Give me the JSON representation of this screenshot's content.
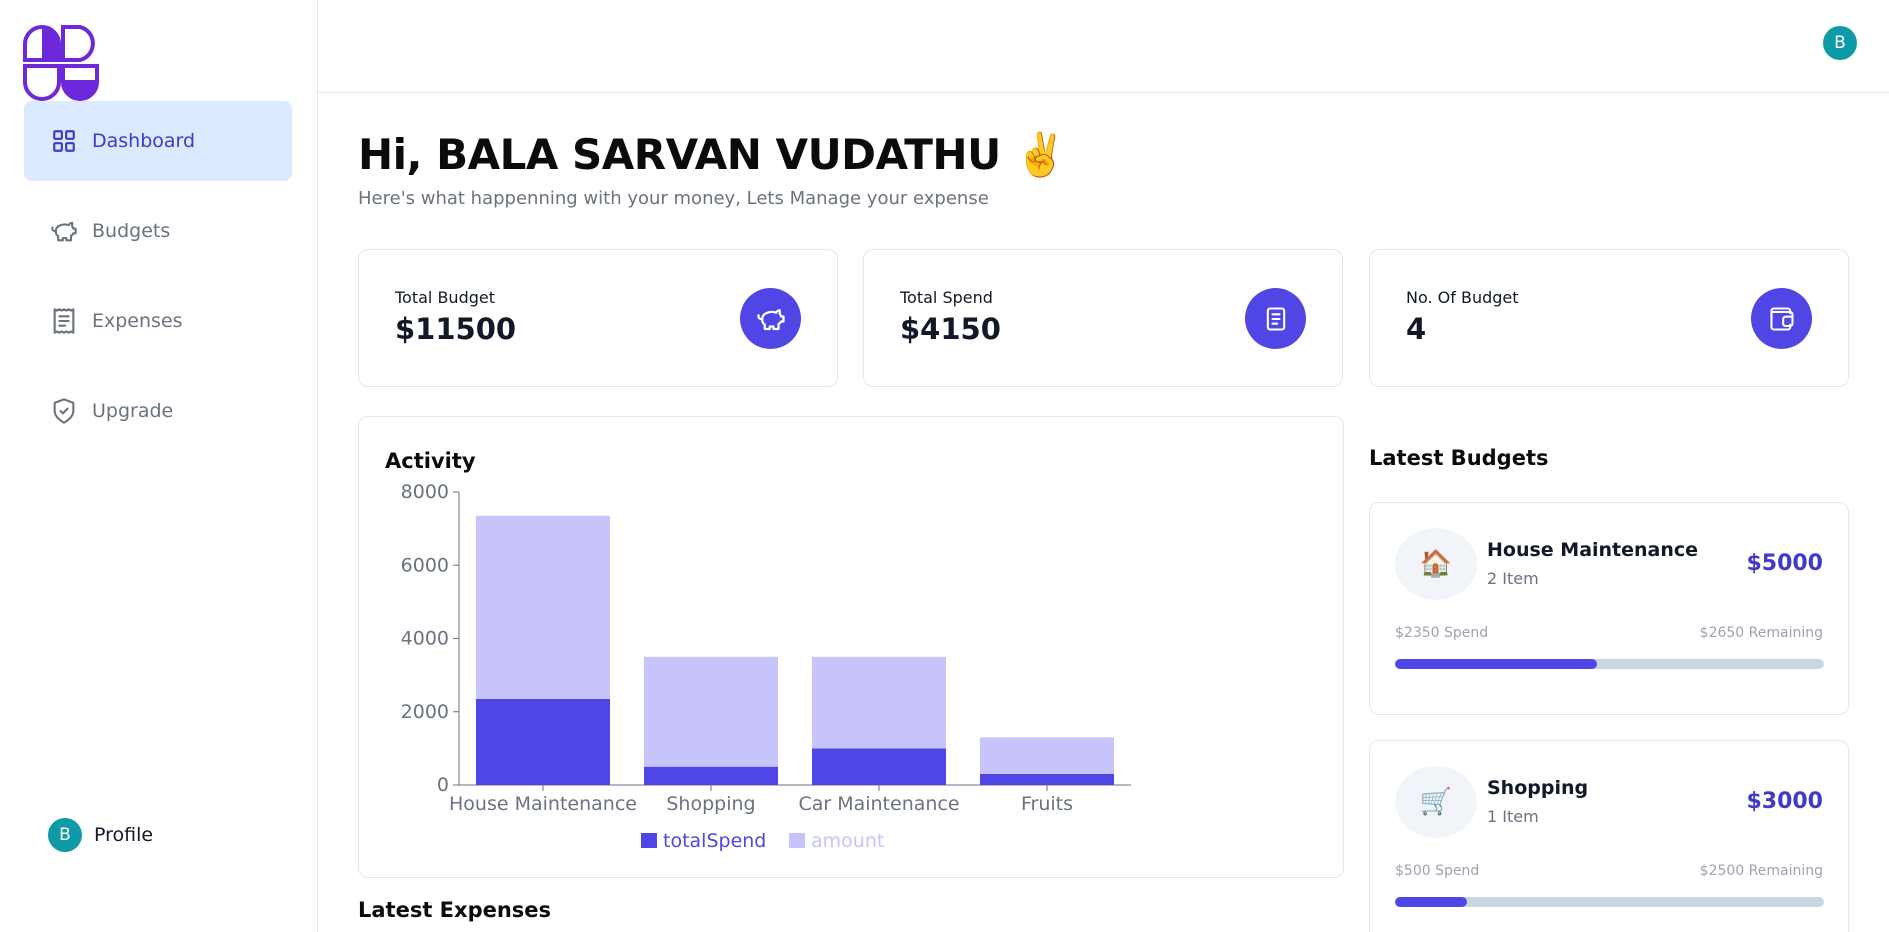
{
  "sidebar": {
    "items": [
      {
        "label": "Dashboard",
        "icon": "dashboard-icon",
        "active": true
      },
      {
        "label": "Budgets",
        "icon": "piggy-bank-icon",
        "active": false
      },
      {
        "label": "Expenses",
        "icon": "receipt-icon",
        "active": false
      },
      {
        "label": "Upgrade",
        "icon": "shield-check-icon",
        "active": false
      }
    ],
    "profile_label": "Profile",
    "profile_initial": "B"
  },
  "header": {
    "avatar_initial": "B"
  },
  "greeting": {
    "title": "Hi, BALA SARVAN VUDATHU ✌️",
    "subtitle": "Here's what happenning with your money, Lets Manage your expense"
  },
  "stats": [
    {
      "label": "Total Budget",
      "value": "$11500",
      "icon": "piggy-bank-icon"
    },
    {
      "label": "Total Spend",
      "value": "$4150",
      "icon": "receipt-icon"
    },
    {
      "label": "No. Of Budget",
      "value": "4",
      "icon": "wallet-icon"
    }
  ],
  "activity": {
    "title": "Activity"
  },
  "chart_data": {
    "type": "bar",
    "stacked": true,
    "categories": [
      "House Maintenance",
      "Shopping",
      "Car Maintenance",
      "Fruits"
    ],
    "series": [
      {
        "name": "totalSpend",
        "values": [
          2350,
          500,
          1000,
          300
        ],
        "color": "#4f46e5"
      },
      {
        "name": "amount",
        "values": [
          5000,
          3000,
          2500,
          1000
        ],
        "color": "#c7c4fc"
      }
    ],
    "ylim": [
      0,
      8000
    ],
    "yticks": [
      0,
      2000,
      4000,
      6000,
      8000
    ],
    "legend": "bottom",
    "grid": false
  },
  "latest_budgets": {
    "title": "Latest Budgets",
    "items": [
      {
        "emoji": "🏠",
        "name": "House Maintenance",
        "items": "2 Item",
        "amount": "$5000",
        "spend": "$2350 Spend",
        "remaining": "$2650 Remaining",
        "progress": 0.47
      },
      {
        "emoji": "🛒",
        "name": "Shopping",
        "items": "1 Item",
        "amount": "$3000",
        "spend": "$500 Spend",
        "remaining": "$2500 Remaining",
        "progress": 0.167
      }
    ]
  },
  "latest_expenses": {
    "title": "Latest Expenses"
  },
  "colors": {
    "accent": "#4f46e5",
    "accent_light": "#c7c4fc",
    "active_nav_bg": "#dbeafe",
    "avatar": "#0e9aa7"
  }
}
